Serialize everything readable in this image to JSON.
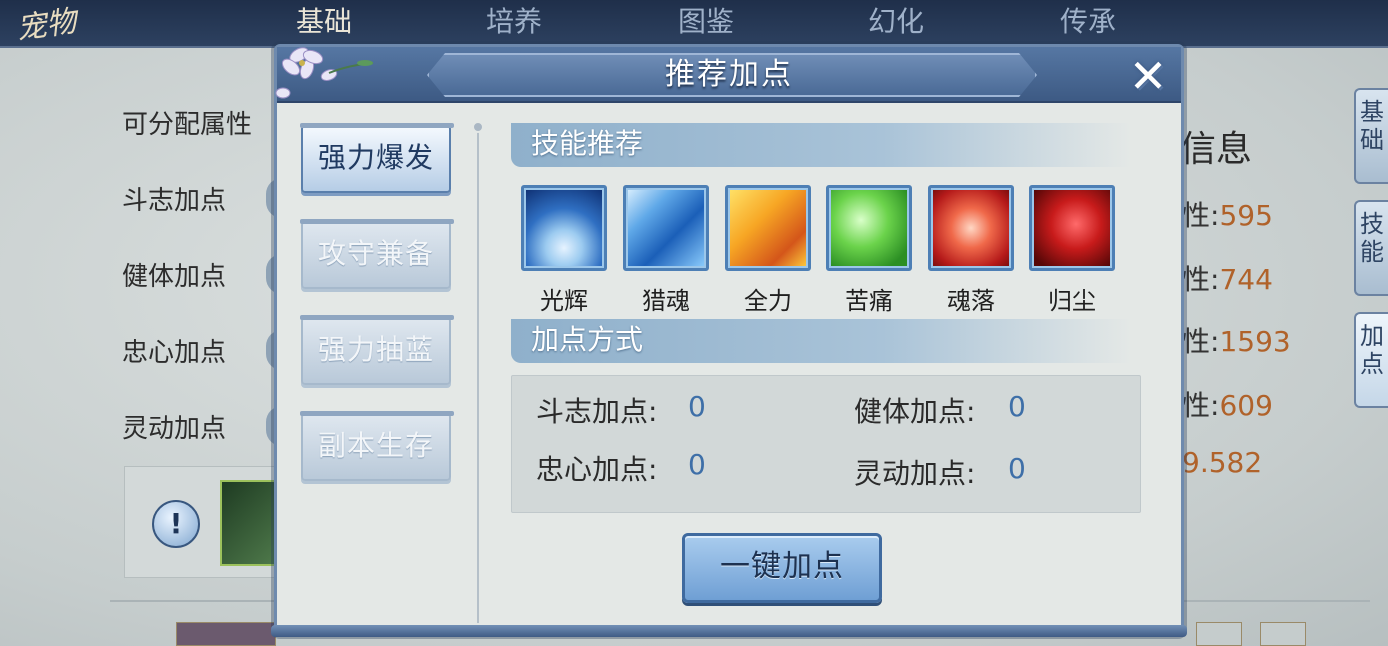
{
  "background": {
    "logo": "宠物",
    "top_tabs": [
      "基础",
      "培养",
      "图鉴",
      "幻化",
      "传承"
    ],
    "left_title": "可分配属性",
    "left_rows": [
      "斗志加点",
      "健体加点",
      "忠心加点",
      "灵动加点"
    ],
    "info_title": "信息",
    "stats": [
      {
        "key": "性:",
        "value": "595"
      },
      {
        "key": "性:",
        "value": "744"
      },
      {
        "key": "性:",
        "value": "1593"
      },
      {
        "key": "性:",
        "value": "609"
      },
      {
        "key": "",
        "value": "9.582"
      }
    ],
    "side_tabs": [
      "基础",
      "技能",
      "加点"
    ],
    "tip_mark": "!"
  },
  "dialog": {
    "title": "推荐加点",
    "close_label": "✕",
    "categories": [
      {
        "label": "强力爆发",
        "active": true
      },
      {
        "label": "攻守兼备",
        "active": false
      },
      {
        "label": "强力抽蓝",
        "active": false
      },
      {
        "label": "副本生存",
        "active": false
      }
    ],
    "skills_header": "技能推荐",
    "skills": [
      {
        "name": "光辉",
        "icon": "moon-glow-icon"
      },
      {
        "name": "猎魂",
        "icon": "ice-shard-icon"
      },
      {
        "name": "全力",
        "icon": "fire-burst-icon"
      },
      {
        "name": "苦痛",
        "icon": "green-skull-icon"
      },
      {
        "name": "魂落",
        "icon": "red-spirit-icon"
      },
      {
        "name": "归尘",
        "icon": "red-beast-icon"
      }
    ],
    "points_header": "加点方式",
    "points": [
      {
        "label": "斗志加点:",
        "value": "0"
      },
      {
        "label": "健体加点:",
        "value": "0"
      },
      {
        "label": "忠心加点:",
        "value": "0"
      },
      {
        "label": "灵动加点:",
        "value": "0"
      }
    ],
    "one_key_label": "一键加点"
  }
}
